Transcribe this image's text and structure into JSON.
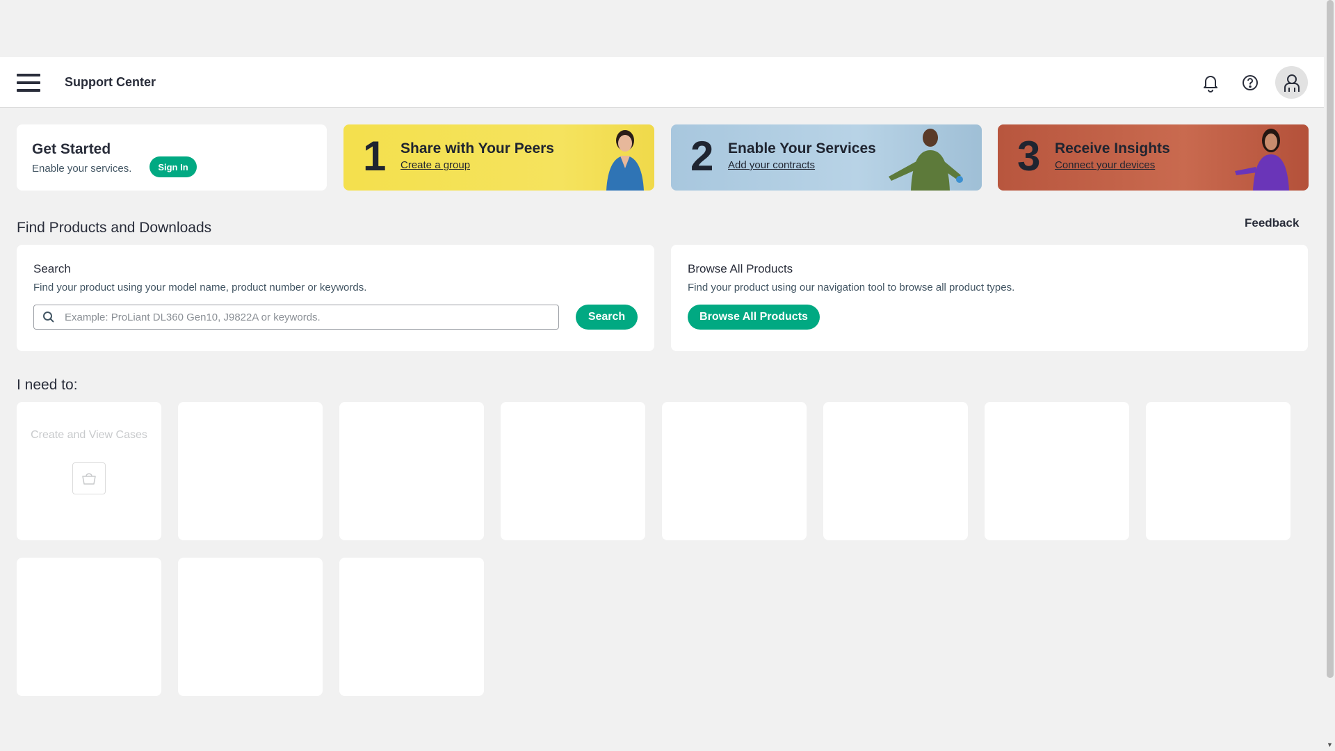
{
  "header": {
    "title": "Support Center",
    "menu_icon": "hamburger-menu-icon",
    "notifications_icon": "bell-icon",
    "help_icon": "help-circle-icon",
    "user_icon": "user-avatar-icon"
  },
  "get_started": {
    "title": "Get Started",
    "subtitle": "Enable your services.",
    "sign_in_label": "Sign In"
  },
  "promos": [
    {
      "number": "1",
      "title": "Share with Your Peers",
      "link": "Create a group",
      "color": "#f4e04d"
    },
    {
      "number": "2",
      "title": "Enable Your Services",
      "link": "Add your contracts",
      "color": "#a8c7de"
    },
    {
      "number": "3",
      "title": "Receive Insights",
      "link": "Connect your devices",
      "color": "#c0603f"
    }
  ],
  "find_section": {
    "title": "Find Products and Downloads",
    "feedback_label": "Feedback"
  },
  "search": {
    "title": "Search",
    "description": "Find your product using your model name, product number or keywords.",
    "placeholder": "Example: ProLiant DL360 Gen10, J9822A or keywords.",
    "value": "",
    "button_label": "Search"
  },
  "browse": {
    "title": "Browse All Products",
    "description": "Find your product using our navigation tool to browse all product types.",
    "button_label": "Browse All Products"
  },
  "need_to": {
    "title": "I need to:",
    "tiles": [
      {
        "label": "Create and View Cases",
        "icon": "shopping-basket-icon"
      },
      {
        "label": ""
      },
      {
        "label": ""
      },
      {
        "label": ""
      },
      {
        "label": ""
      },
      {
        "label": ""
      },
      {
        "label": ""
      },
      {
        "label": ""
      },
      {
        "label": ""
      },
      {
        "label": ""
      },
      {
        "label": ""
      }
    ]
  },
  "colors": {
    "accent": "#01a982",
    "background": "#f1f1f1",
    "text": "#292d3a"
  }
}
